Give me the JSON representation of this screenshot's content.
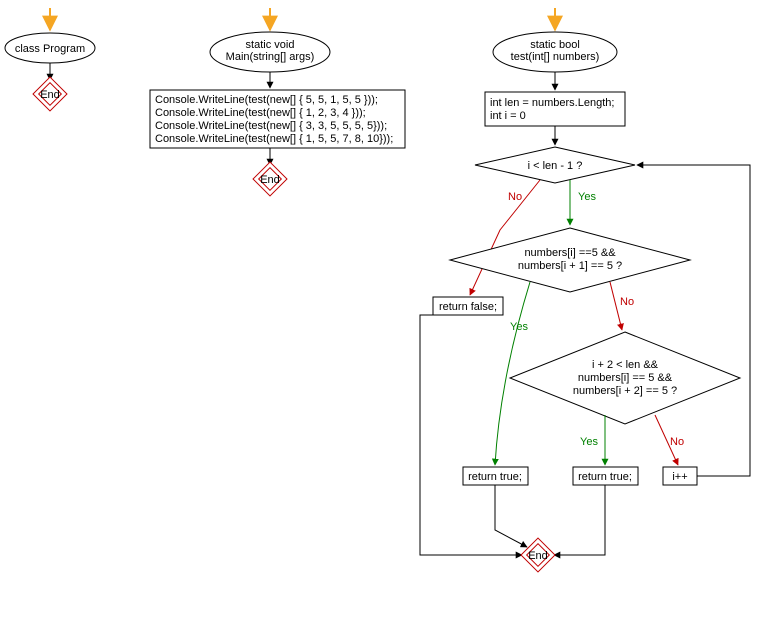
{
  "flowcharts": [
    {
      "id": "program",
      "nodes": {
        "terminal": "class Program",
        "end": "End"
      }
    },
    {
      "id": "main",
      "nodes": {
        "terminal": "static void\nMain(string[] args)",
        "body_lines": [
          "Console.WriteLine(test(new[] { 5, 5, 1, 5, 5 }));",
          "Console.WriteLine(test(new[] { 1, 2, 3, 4 }));",
          "Console.WriteLine(test(new[] { 3, 3, 5, 5, 5, 5}));",
          "Console.WriteLine(test(new[] { 1, 5, 5, 7, 8, 10}));"
        ],
        "end": "End"
      }
    },
    {
      "id": "test",
      "nodes": {
        "terminal": "static bool\ntest(int[] numbers)",
        "init_lines": [
          "int len = numbers.Length;",
          "int i = 0"
        ],
        "cond_loop": "i < len - 1 ?",
        "cond_adj": "numbers[i] ==5 &&\nnumbers[i + 1] == 5 ?",
        "cond_gap": "i + 2 < len &&\nnumbers[i] == 5 &&\nnumbers[i + 2] == 5 ?",
        "return_false": "return false;",
        "return_true_1": "return true;",
        "return_true_2": "return true;",
        "inc": "i++",
        "end": "End"
      },
      "labels": {
        "yes": "Yes",
        "no": "No"
      }
    }
  ],
  "chart_data": {
    "type": "flowchart",
    "subcharts": [
      {
        "name": "Program",
        "nodes": [
          {
            "id": "P1",
            "shape": "terminal",
            "text": "class Program"
          },
          {
            "id": "P2",
            "shape": "end",
            "text": "End"
          }
        ],
        "edges": [
          {
            "from": "ENTRY",
            "to": "P1"
          },
          {
            "from": "P1",
            "to": "P2"
          }
        ]
      },
      {
        "name": "Main",
        "nodes": [
          {
            "id": "M1",
            "shape": "terminal",
            "text": "static void Main(string[] args)"
          },
          {
            "id": "M2",
            "shape": "process",
            "text": "Console.WriteLine(test(new[] { 5, 5, 1, 5, 5 })); Console.WriteLine(test(new[] { 1, 2, 3, 4 })); Console.WriteLine(test(new[] { 3, 3, 5, 5, 5, 5})); Console.WriteLine(test(new[] { 1, 5, 5, 7, 8, 10}));"
          },
          {
            "id": "M3",
            "shape": "end",
            "text": "End"
          }
        ],
        "edges": [
          {
            "from": "ENTRY",
            "to": "M1"
          },
          {
            "from": "M1",
            "to": "M2"
          },
          {
            "from": "M2",
            "to": "M3"
          }
        ]
      },
      {
        "name": "test",
        "nodes": [
          {
            "id": "T1",
            "shape": "terminal",
            "text": "static bool test(int[] numbers)"
          },
          {
            "id": "T2",
            "shape": "process",
            "text": "int len = numbers.Length; int i = 0"
          },
          {
            "id": "T3",
            "shape": "decision",
            "text": "i < len - 1 ?"
          },
          {
            "id": "T4",
            "shape": "decision",
            "text": "numbers[i] ==5 && numbers[i + 1] == 5 ?"
          },
          {
            "id": "T5",
            "shape": "decision",
            "text": "i + 2 < len && numbers[i] == 5 && numbers[i + 2] == 5 ?"
          },
          {
            "id": "T6",
            "shape": "process",
            "text": "return false;"
          },
          {
            "id": "T7",
            "shape": "process",
            "text": "return true;"
          },
          {
            "id": "T8",
            "shape": "process",
            "text": "return true;"
          },
          {
            "id": "T9",
            "shape": "process",
            "text": "i++"
          },
          {
            "id": "T10",
            "shape": "end",
            "text": "End"
          }
        ],
        "edges": [
          {
            "from": "ENTRY",
            "to": "T1"
          },
          {
            "from": "T1",
            "to": "T2"
          },
          {
            "from": "T2",
            "to": "T3"
          },
          {
            "from": "T3",
            "to": "T4",
            "label": "Yes"
          },
          {
            "from": "T3",
            "to": "T6",
            "label": "No"
          },
          {
            "from": "T4",
            "to": "T7",
            "label": "Yes"
          },
          {
            "from": "T4",
            "to": "T5",
            "label": "No"
          },
          {
            "from": "T5",
            "to": "T8",
            "label": "Yes"
          },
          {
            "from": "T5",
            "to": "T9",
            "label": "No"
          },
          {
            "from": "T9",
            "to": "T3"
          },
          {
            "from": "T8",
            "to": "T10"
          },
          {
            "from": "T7",
            "to": "T10"
          },
          {
            "from": "T6",
            "to": "T10"
          }
        ]
      }
    ]
  }
}
